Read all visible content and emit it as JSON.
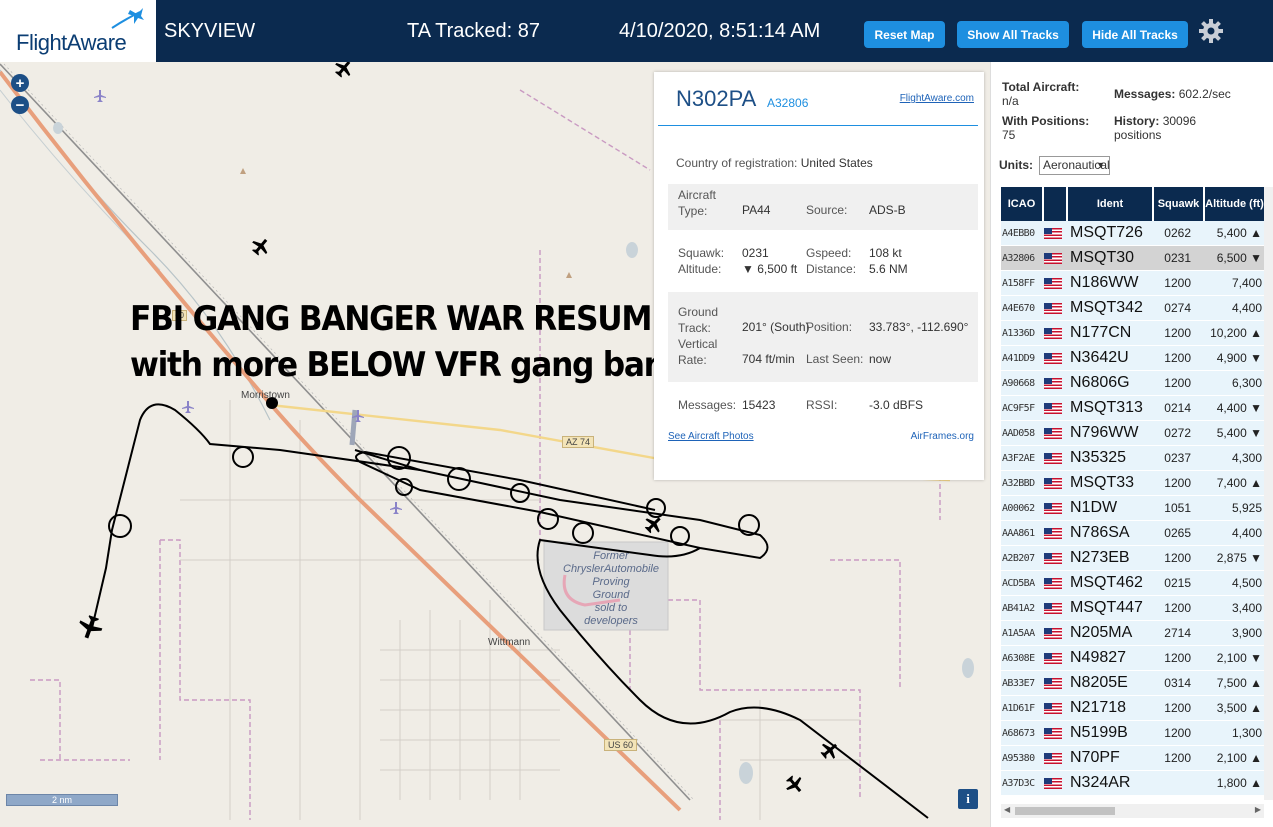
{
  "header": {
    "logo_text": "FlightAware",
    "app_name": "SKYVIEW",
    "ta_tracked": "TA Tracked: 87",
    "clock": "4/10/2020, 8:51:14 AM",
    "buttons": {
      "reset": "Reset Map",
      "show": "Show All Tracks",
      "hide": "Hide All Tracks"
    },
    "settings_icon": "gear-icon"
  },
  "map": {
    "overlay_line1": "FBI GANG BANGER WAR RESUMES",
    "overlay_line2": "with more BELOW VFR gang banging",
    "scale": "2 nm",
    "info": "i",
    "places": {
      "morristown": "Morristown",
      "wittmann": "Wittmann",
      "az74": "AZ 74",
      "us60": "US 60",
      "us60b": "60"
    },
    "former_site": [
      "Former",
      "ChryslerAutomobile",
      "Proving",
      "Ground",
      "sold to",
      "developers"
    ]
  },
  "selected": {
    "ident": "N302PA",
    "icao": "A32806",
    "fa_link": "FlightAware.com",
    "country_label": "Country of registration:",
    "country": "United States",
    "aircraft_type_label": "Aircraft Type:",
    "aircraft_type": "PA44",
    "source_label": "Source:",
    "source": "ADS-B",
    "squawk_label": "Squawk:",
    "squawk": "0231",
    "gspeed_label": "Gspeed:",
    "gspeed": "108 kt",
    "altitude_label": "Altitude:",
    "altitude": "▼ 6,500 ft",
    "distance_label": "Distance:",
    "distance": "5.6 NM",
    "ground_track_label": "Ground Track:",
    "ground_track": "201° (South)",
    "position_label": "Position:",
    "position": "33.783°, -112.690°",
    "vertical_rate_label": "Vertical Rate:",
    "vertical_rate": "704 ft/min",
    "last_seen_label": "Last Seen:",
    "last_seen": "now",
    "messages_label": "Messages:",
    "messages": "15423",
    "rssi_label": "RSSI:",
    "rssi": "-3.0 dBFS",
    "photos_link": "See Aircraft Photos",
    "airframes_link": "AirFrames.org"
  },
  "stats": {
    "total_label": "Total Aircraft:",
    "total": "n/a",
    "messages_label": "Messages:",
    "messages": "602.2/sec",
    "positions_label": "With Positions:",
    "positions": "75",
    "history_label": "History:",
    "history": "30096 positions",
    "units_label": "Units:",
    "units": "Aeronautical"
  },
  "table": {
    "headers": {
      "icao": "ICAO",
      "ident": "Ident",
      "squawk": "Squawk",
      "altitude": "Altitude (ft)"
    },
    "rows": [
      {
        "icao": "A4EBB0",
        "ident": "MSQT726",
        "squawk": "0262",
        "alt": "5,400 ▲"
      },
      {
        "icao": "A32806",
        "ident": "MSQT30",
        "squawk": "0231",
        "alt": "6,500 ▼"
      },
      {
        "icao": "A158FF",
        "ident": "N186WW",
        "squawk": "1200",
        "alt": "7,400"
      },
      {
        "icao": "A4E670",
        "ident": "MSQT342",
        "squawk": "0274",
        "alt": "4,400"
      },
      {
        "icao": "A1336D",
        "ident": "N177CN",
        "squawk": "1200",
        "alt": "10,200 ▲"
      },
      {
        "icao": "A41DD9",
        "ident": "N3642U",
        "squawk": "1200",
        "alt": "4,900 ▼"
      },
      {
        "icao": "A90668",
        "ident": "N6806G",
        "squawk": "1200",
        "alt": "6,300"
      },
      {
        "icao": "AC9F5F",
        "ident": "MSQT313",
        "squawk": "0214",
        "alt": "4,400 ▼"
      },
      {
        "icao": "AAD058",
        "ident": "N796WW",
        "squawk": "0272",
        "alt": "5,400 ▼"
      },
      {
        "icao": "A3F2AE",
        "ident": "N35325",
        "squawk": "0237",
        "alt": "4,300"
      },
      {
        "icao": "A32BBD",
        "ident": "MSQT33",
        "squawk": "1200",
        "alt": "7,400 ▲"
      },
      {
        "icao": "A00062",
        "ident": "N1DW",
        "squawk": "1051",
        "alt": "5,925"
      },
      {
        "icao": "AAA861",
        "ident": "N786SA",
        "squawk": "0265",
        "alt": "4,400"
      },
      {
        "icao": "A2B207",
        "ident": "N273EB",
        "squawk": "1200",
        "alt": "2,875 ▼"
      },
      {
        "icao": "ACD5BA",
        "ident": "MSQT462",
        "squawk": "0215",
        "alt": "4,500"
      },
      {
        "icao": "AB41A2",
        "ident": "MSQT447",
        "squawk": "1200",
        "alt": "3,400"
      },
      {
        "icao": "A1A5AA",
        "ident": "N205MA",
        "squawk": "2714",
        "alt": "3,900"
      },
      {
        "icao": "A6308E",
        "ident": "N49827",
        "squawk": "1200",
        "alt": "2,100 ▼"
      },
      {
        "icao": "AB33E7",
        "ident": "N8205E",
        "squawk": "0314",
        "alt": "7,500 ▲"
      },
      {
        "icao": "A1D61F",
        "ident": "N21718",
        "squawk": "1200",
        "alt": "3,500 ▲"
      },
      {
        "icao": "A68673",
        "ident": "N5199B",
        "squawk": "1200",
        "alt": "1,300"
      },
      {
        "icao": "A95380",
        "ident": "N70PF",
        "squawk": "1200",
        "alt": "2,100 ▲"
      },
      {
        "icao": "A37D3C",
        "ident": "N324AR",
        "squawk": "",
        "alt": "1,800 ▲"
      }
    ]
  }
}
